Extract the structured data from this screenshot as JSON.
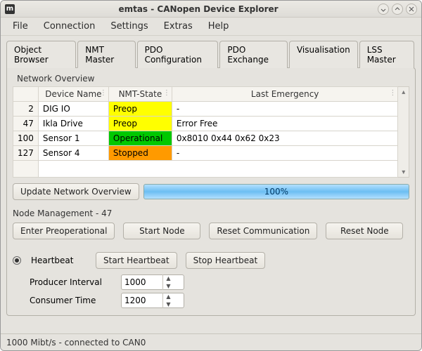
{
  "window": {
    "title": "emtas - CANopen Device Explorer"
  },
  "menu": {
    "file": "File",
    "connection": "Connection",
    "settings": "Settings",
    "extras": "Extras",
    "help": "Help"
  },
  "tabs": {
    "objectBrowser": "Object Browser",
    "nmtMaster": "NMT Master",
    "pdoConfig": "PDO Configuration",
    "pdoExchange": "PDO Exchange",
    "visualisation": "Visualisation",
    "lssMaster": "LSS Master"
  },
  "overview": {
    "groupLabel": "Network Overview",
    "headers": {
      "deviceName": "Device Name",
      "nmtState": "NMT-State",
      "lastEmergency": "Last Emergency"
    },
    "rows": [
      {
        "id": "2",
        "name": "DIG IO",
        "state": "Preop",
        "stateClass": "nmt-yellow",
        "emergency": "-"
      },
      {
        "id": "47",
        "name": "Ikla Drive",
        "state": "Preop",
        "stateClass": "nmt-yellow",
        "emergency": "Error Free"
      },
      {
        "id": "100",
        "name": "Sensor 1",
        "state": "Operational",
        "stateClass": "nmt-green",
        "emergency": "0x8010 0x44 0x62 0x23"
      },
      {
        "id": "127",
        "name": "Sensor 4",
        "state": "Stopped",
        "stateClass": "nmt-orange",
        "emergency": "-"
      }
    ],
    "updateBtn": "Update Network Overview",
    "progress": "100%"
  },
  "nodeMgmt": {
    "label": "Node Management  -  47",
    "enterPreop": "Enter Preoperational",
    "startNode": "Start Node",
    "resetComm": "Reset Communication",
    "resetNode": "Reset Node"
  },
  "heartbeat": {
    "label": "Heartbeat",
    "start": "Start Heartbeat",
    "stop": "Stop Heartbeat",
    "producerLabel": "Producer Interval",
    "producerValue": "1000",
    "consumerLabel": "Consumer Time",
    "consumerValue": "1200"
  },
  "status": "1000 Mibt/s - connected to CAN0"
}
